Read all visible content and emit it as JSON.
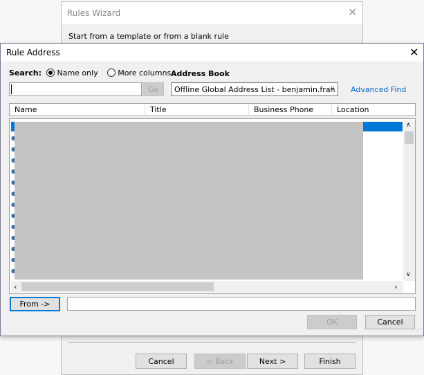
{
  "wizard": {
    "title": "Rules Wizard",
    "subtitle": "Start from a template or from a blank rule",
    "buttons": {
      "cancel": "Cancel",
      "back": "< Back",
      "next": "Next >",
      "finish": "Finish"
    }
  },
  "dialog": {
    "title": "Rule Address",
    "search_label": "Search:",
    "radio_name_only": "Name only",
    "radio_more_columns": "More columns",
    "selected_radio": "Name only",
    "search_value": "",
    "go_label": "Go",
    "address_book_label": "Address Book",
    "address_book_value": "Offline Global Address List - benjamin.fran",
    "advanced_find": "Advanced Find",
    "columns": [
      "Name",
      "Title",
      "Business Phone",
      "Location"
    ],
    "from_button": "From ->",
    "from_value": "",
    "ok": "OK",
    "cancel": "Cancel"
  },
  "colors": {
    "selection": "#0078d7",
    "link": "#0066cc",
    "redaction": "#c4c4c4"
  }
}
